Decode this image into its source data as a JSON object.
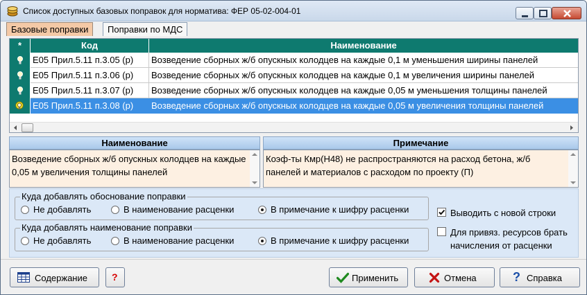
{
  "window": {
    "title": "Список доступных базовых поправок для норматива: ФЕР 05-02-004-01"
  },
  "tabs": [
    {
      "label": "Базовые поправки",
      "active": true
    },
    {
      "label": "Поправки по МДС",
      "active": false
    }
  ],
  "grid": {
    "columns": {
      "star": "*",
      "code": "Код",
      "name": "Наименование"
    },
    "rows": [
      {
        "code": "Е05 Прил.5.11 п.3.05 (р)",
        "name": "Возведение сборных ж/б опускных колодцев на каждые 0,1 м уменьшения ширины панелей",
        "selected": false
      },
      {
        "code": "Е05 Прил.5.11 п.3.06 (р)",
        "name": "Возведение сборных ж/б опускных колодцев на каждые 0,1 м увеличения ширины панелей",
        "selected": false
      },
      {
        "code": "Е05 Прил.5.11 п.3.07 (р)",
        "name": "Возведение сборных ж/б опускных колодцев на каждые 0,05 м уменьшения толщины панелей",
        "selected": false
      },
      {
        "code": "Е05 Прил.5.11 п.3.08 (р)",
        "name": "Возведение сборных ж/б опускных колодцев на каждые 0,05 м увеличения толщины панелей",
        "selected": true
      }
    ]
  },
  "details": {
    "name_header": "Наименование",
    "note_header": "Примечание",
    "name_text": "Возведение сборных ж/б опускных колодцев на каждые 0,05 м увеличения толщины панелей",
    "note_text": "Коэф-ты Кмр(Н48) не распространяются на расход бетона, ж/б панелей и материалов с расходом по проекту (П)"
  },
  "options": {
    "justification": {
      "legend": "Куда добавлять обоснование поправки",
      "choices": [
        "Не добавлять",
        "В наименование расценки",
        "В примечание к шифру расценки"
      ],
      "selected_index": 2
    },
    "naming": {
      "legend": "Куда добавлять наименование поправки",
      "choices": [
        "Не добавлять",
        "В наименование расценки",
        "В примечание к шифру расценки"
      ],
      "selected_index": 2
    },
    "new_line": {
      "label": "Выводить с новой строки",
      "checked": true
    },
    "resources": {
      "label_line1": "Для привяз. ресурсов брать",
      "label_line2": "начисления от расценки",
      "checked": false
    }
  },
  "buttons": {
    "contents": "Содержание",
    "question": "?",
    "apply": "Применить",
    "cancel": "Отмена",
    "help": "Справка"
  },
  "colors": {
    "grid_header": "#0e7a6f",
    "selection": "#3b8fe4",
    "detail_bg": "#fdf0e2",
    "active_tab": "#f4c9a6",
    "options_bg": "#dbe8f7"
  }
}
